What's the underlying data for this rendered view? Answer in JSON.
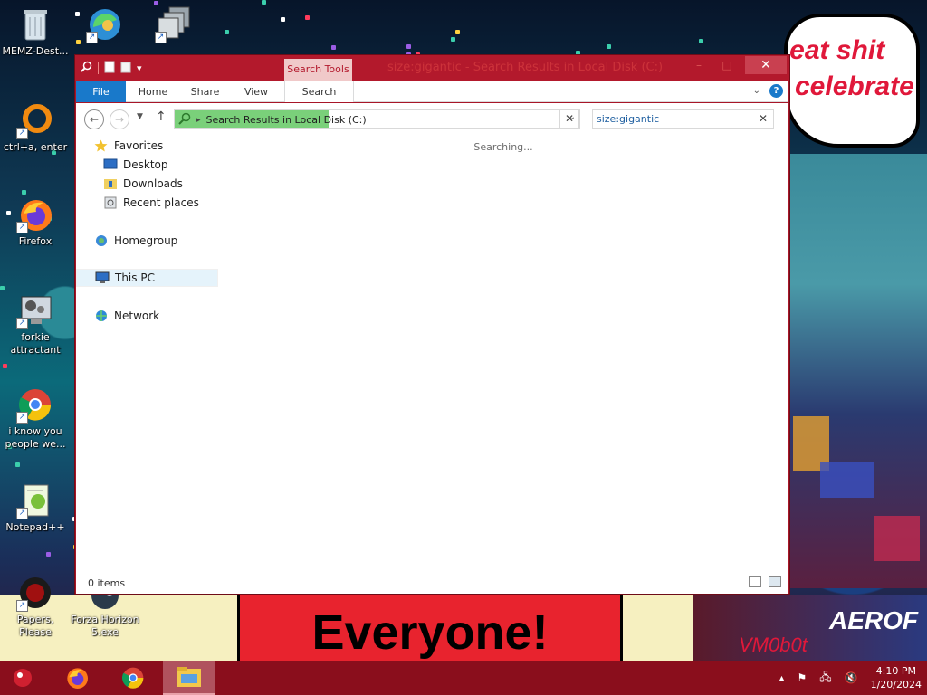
{
  "desktop": {
    "icons": [
      {
        "label": "MEMZ-Dest...",
        "icon": "recycle-bin-icon"
      },
      {
        "label": "",
        "icon": "edge-icon"
      },
      {
        "label": "",
        "icon": "copy-windows-icon"
      },
      {
        "label": "ctrl+a, enter",
        "icon": "orange-ring-icon"
      },
      {
        "label": "Firefox",
        "icon": "firefox-icon"
      },
      {
        "label": "forkie attractant",
        "icon": "gear-monitor-icon"
      },
      {
        "label": "i know you people we...",
        "icon": "chrome-icon"
      },
      {
        "label": "Notepad++",
        "icon": "notepadpp-icon"
      },
      {
        "label": "Papers, Please",
        "icon": "papers-please-icon"
      },
      {
        "label": "Forza Horizon 5.exe",
        "icon": "steam-icon"
      }
    ],
    "bubble_line1": "it's time to eat shit",
    "bubble_line2": "celebrate",
    "banner_text": "Everyone!",
    "banner_brand": "AEROF",
    "banner_sign": "VM0b0t"
  },
  "window": {
    "title": "size:gigantic - Search Results in Local Disk (C:)",
    "context_tab": "Search Tools",
    "close_label": "✕",
    "ribbon_tabs": [
      "File",
      "Home",
      "Share",
      "View",
      "Search"
    ],
    "address": {
      "root_icon": "search-icon",
      "location": "Search Results in Local Disk (C:)"
    },
    "search": {
      "value": "size:gigantic",
      "placeholder": ""
    },
    "nav": {
      "favorites": "Favorites",
      "desktop": "Desktop",
      "downloads": "Downloads",
      "recent": "Recent places",
      "homegroup": "Homegroup",
      "this_pc": "This PC",
      "network": "Network"
    },
    "status_message": "Searching...",
    "item_count": "0 items"
  },
  "taskbar": {
    "time": "4:10 PM",
    "date": "1/20/2024"
  }
}
